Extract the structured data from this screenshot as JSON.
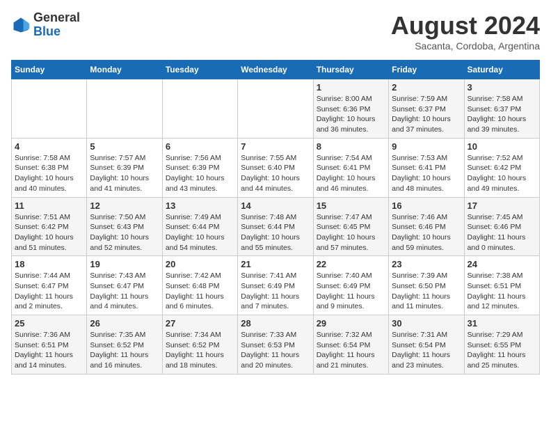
{
  "logo": {
    "general": "General",
    "blue": "Blue"
  },
  "title": {
    "month_year": "August 2024",
    "location": "Sacanta, Cordoba, Argentina"
  },
  "days_of_week": [
    "Sunday",
    "Monday",
    "Tuesday",
    "Wednesday",
    "Thursday",
    "Friday",
    "Saturday"
  ],
  "weeks": [
    [
      {
        "day": "",
        "info": ""
      },
      {
        "day": "",
        "info": ""
      },
      {
        "day": "",
        "info": ""
      },
      {
        "day": "",
        "info": ""
      },
      {
        "day": "1",
        "info": "Sunrise: 8:00 AM\nSunset: 6:36 PM\nDaylight: 10 hours\nand 36 minutes."
      },
      {
        "day": "2",
        "info": "Sunrise: 7:59 AM\nSunset: 6:37 PM\nDaylight: 10 hours\nand 37 minutes."
      },
      {
        "day": "3",
        "info": "Sunrise: 7:58 AM\nSunset: 6:37 PM\nDaylight: 10 hours\nand 39 minutes."
      }
    ],
    [
      {
        "day": "4",
        "info": "Sunrise: 7:58 AM\nSunset: 6:38 PM\nDaylight: 10 hours\nand 40 minutes."
      },
      {
        "day": "5",
        "info": "Sunrise: 7:57 AM\nSunset: 6:39 PM\nDaylight: 10 hours\nand 41 minutes."
      },
      {
        "day": "6",
        "info": "Sunrise: 7:56 AM\nSunset: 6:39 PM\nDaylight: 10 hours\nand 43 minutes."
      },
      {
        "day": "7",
        "info": "Sunrise: 7:55 AM\nSunset: 6:40 PM\nDaylight: 10 hours\nand 44 minutes."
      },
      {
        "day": "8",
        "info": "Sunrise: 7:54 AM\nSunset: 6:41 PM\nDaylight: 10 hours\nand 46 minutes."
      },
      {
        "day": "9",
        "info": "Sunrise: 7:53 AM\nSunset: 6:41 PM\nDaylight: 10 hours\nand 48 minutes."
      },
      {
        "day": "10",
        "info": "Sunrise: 7:52 AM\nSunset: 6:42 PM\nDaylight: 10 hours\nand 49 minutes."
      }
    ],
    [
      {
        "day": "11",
        "info": "Sunrise: 7:51 AM\nSunset: 6:42 PM\nDaylight: 10 hours\nand 51 minutes."
      },
      {
        "day": "12",
        "info": "Sunrise: 7:50 AM\nSunset: 6:43 PM\nDaylight: 10 hours\nand 52 minutes."
      },
      {
        "day": "13",
        "info": "Sunrise: 7:49 AM\nSunset: 6:44 PM\nDaylight: 10 hours\nand 54 minutes."
      },
      {
        "day": "14",
        "info": "Sunrise: 7:48 AM\nSunset: 6:44 PM\nDaylight: 10 hours\nand 55 minutes."
      },
      {
        "day": "15",
        "info": "Sunrise: 7:47 AM\nSunset: 6:45 PM\nDaylight: 10 hours\nand 57 minutes."
      },
      {
        "day": "16",
        "info": "Sunrise: 7:46 AM\nSunset: 6:46 PM\nDaylight: 10 hours\nand 59 minutes."
      },
      {
        "day": "17",
        "info": "Sunrise: 7:45 AM\nSunset: 6:46 PM\nDaylight: 11 hours\nand 0 minutes."
      }
    ],
    [
      {
        "day": "18",
        "info": "Sunrise: 7:44 AM\nSunset: 6:47 PM\nDaylight: 11 hours\nand 2 minutes."
      },
      {
        "day": "19",
        "info": "Sunrise: 7:43 AM\nSunset: 6:47 PM\nDaylight: 11 hours\nand 4 minutes."
      },
      {
        "day": "20",
        "info": "Sunrise: 7:42 AM\nSunset: 6:48 PM\nDaylight: 11 hours\nand 6 minutes."
      },
      {
        "day": "21",
        "info": "Sunrise: 7:41 AM\nSunset: 6:49 PM\nDaylight: 11 hours\nand 7 minutes."
      },
      {
        "day": "22",
        "info": "Sunrise: 7:40 AM\nSunset: 6:49 PM\nDaylight: 11 hours\nand 9 minutes."
      },
      {
        "day": "23",
        "info": "Sunrise: 7:39 AM\nSunset: 6:50 PM\nDaylight: 11 hours\nand 11 minutes."
      },
      {
        "day": "24",
        "info": "Sunrise: 7:38 AM\nSunset: 6:51 PM\nDaylight: 11 hours\nand 12 minutes."
      }
    ],
    [
      {
        "day": "25",
        "info": "Sunrise: 7:36 AM\nSunset: 6:51 PM\nDaylight: 11 hours\nand 14 minutes."
      },
      {
        "day": "26",
        "info": "Sunrise: 7:35 AM\nSunset: 6:52 PM\nDaylight: 11 hours\nand 16 minutes."
      },
      {
        "day": "27",
        "info": "Sunrise: 7:34 AM\nSunset: 6:52 PM\nDaylight: 11 hours\nand 18 minutes."
      },
      {
        "day": "28",
        "info": "Sunrise: 7:33 AM\nSunset: 6:53 PM\nDaylight: 11 hours\nand 20 minutes."
      },
      {
        "day": "29",
        "info": "Sunrise: 7:32 AM\nSunset: 6:54 PM\nDaylight: 11 hours\nand 21 minutes."
      },
      {
        "day": "30",
        "info": "Sunrise: 7:31 AM\nSunset: 6:54 PM\nDaylight: 11 hours\nand 23 minutes."
      },
      {
        "day": "31",
        "info": "Sunrise: 7:29 AM\nSunset: 6:55 PM\nDaylight: 11 hours\nand 25 minutes."
      }
    ]
  ]
}
